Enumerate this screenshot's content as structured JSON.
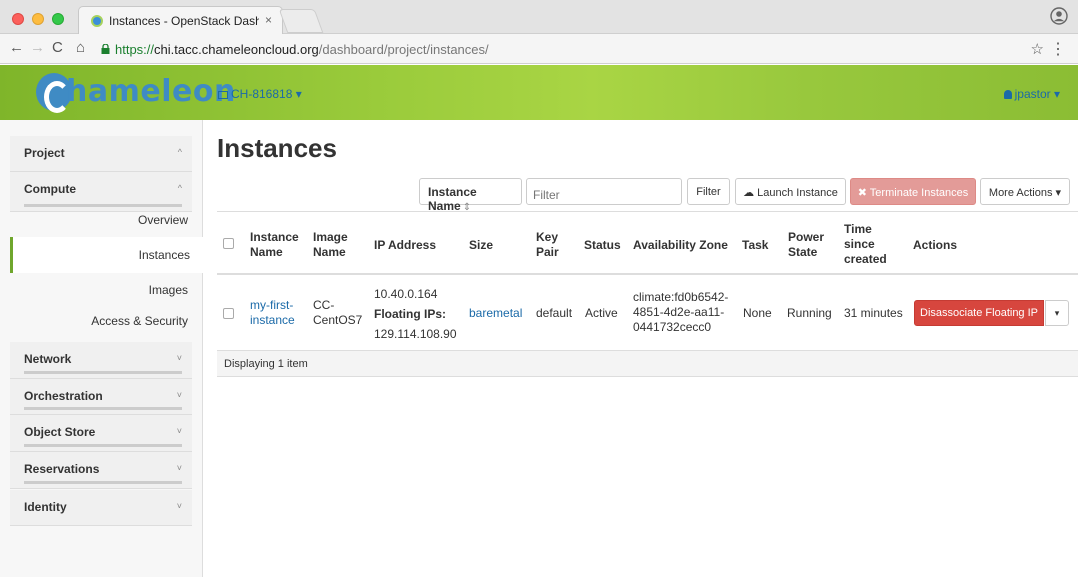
{
  "browser": {
    "tab_title": "Instances - OpenStack Dashbo",
    "tab_close": "×",
    "url_scheme": "https://",
    "url_host": "chi.tacc.chameleoncloud.org",
    "url_path": "/dashboard/project/instances/",
    "back": "←",
    "forward": "→",
    "reload": "C",
    "home": "⌂",
    "star": "☆",
    "kebab": "⋮"
  },
  "header": {
    "logo_text": "hameleon",
    "project": "CH-816818 ▾",
    "user": "jpastor ▾"
  },
  "sidebar": {
    "project": {
      "label": "Project",
      "chevron": "^"
    },
    "compute": {
      "label": "Compute",
      "chevron": "^"
    },
    "items": [
      "Overview",
      "Instances",
      "Images",
      "Access & Security"
    ],
    "network": {
      "label": "Network",
      "chevron": "˅"
    },
    "orchestration": {
      "label": "Orchestration",
      "chevron": "˅"
    },
    "object_store": {
      "label": "Object Store",
      "chevron": "˅"
    },
    "reservations": {
      "label": "Reservations",
      "chevron": "˅"
    },
    "identity": {
      "label": "Identity",
      "chevron": "˅"
    }
  },
  "main": {
    "title": "Instances",
    "filter_field": "Instance Name",
    "filter_arrows": "⇕",
    "filter_placeholder": "Filter",
    "filter_button": "Filter",
    "launch_button": "☁ Launch Instance",
    "terminate_button": "✖ Terminate Instances",
    "more_actions": "More Actions ▾"
  },
  "table": {
    "headers": {
      "name": [
        "Instance",
        "Name"
      ],
      "image": [
        "Image",
        "Name"
      ],
      "ip": "IP Address",
      "size": "Size",
      "keypair": [
        "Key",
        "Pair"
      ],
      "status": "Status",
      "az": "Availability Zone",
      "task": "Task",
      "power": [
        "Power",
        "State"
      ],
      "time": [
        "Time",
        "since",
        "created"
      ],
      "actions": "Actions"
    },
    "rows": [
      {
        "name": [
          "my-first-",
          "instance"
        ],
        "image": [
          "CC-",
          "CentOS7"
        ],
        "ip_fixed": "10.40.0.164",
        "ip_floating_label": "Floating IPs:",
        "ip_floating": "129.114.108.90",
        "size": "baremetal",
        "keypair": "default",
        "status": "Active",
        "az": [
          "climate:fd0b6542-",
          "4851-4d2e-aa11-",
          "0441732cecc0"
        ],
        "task": "None",
        "power": "Running",
        "time": "31 minutes",
        "action": "Disassociate Floating IP",
        "caret": "▾"
      }
    ],
    "footer": "Displaying 1 item"
  }
}
